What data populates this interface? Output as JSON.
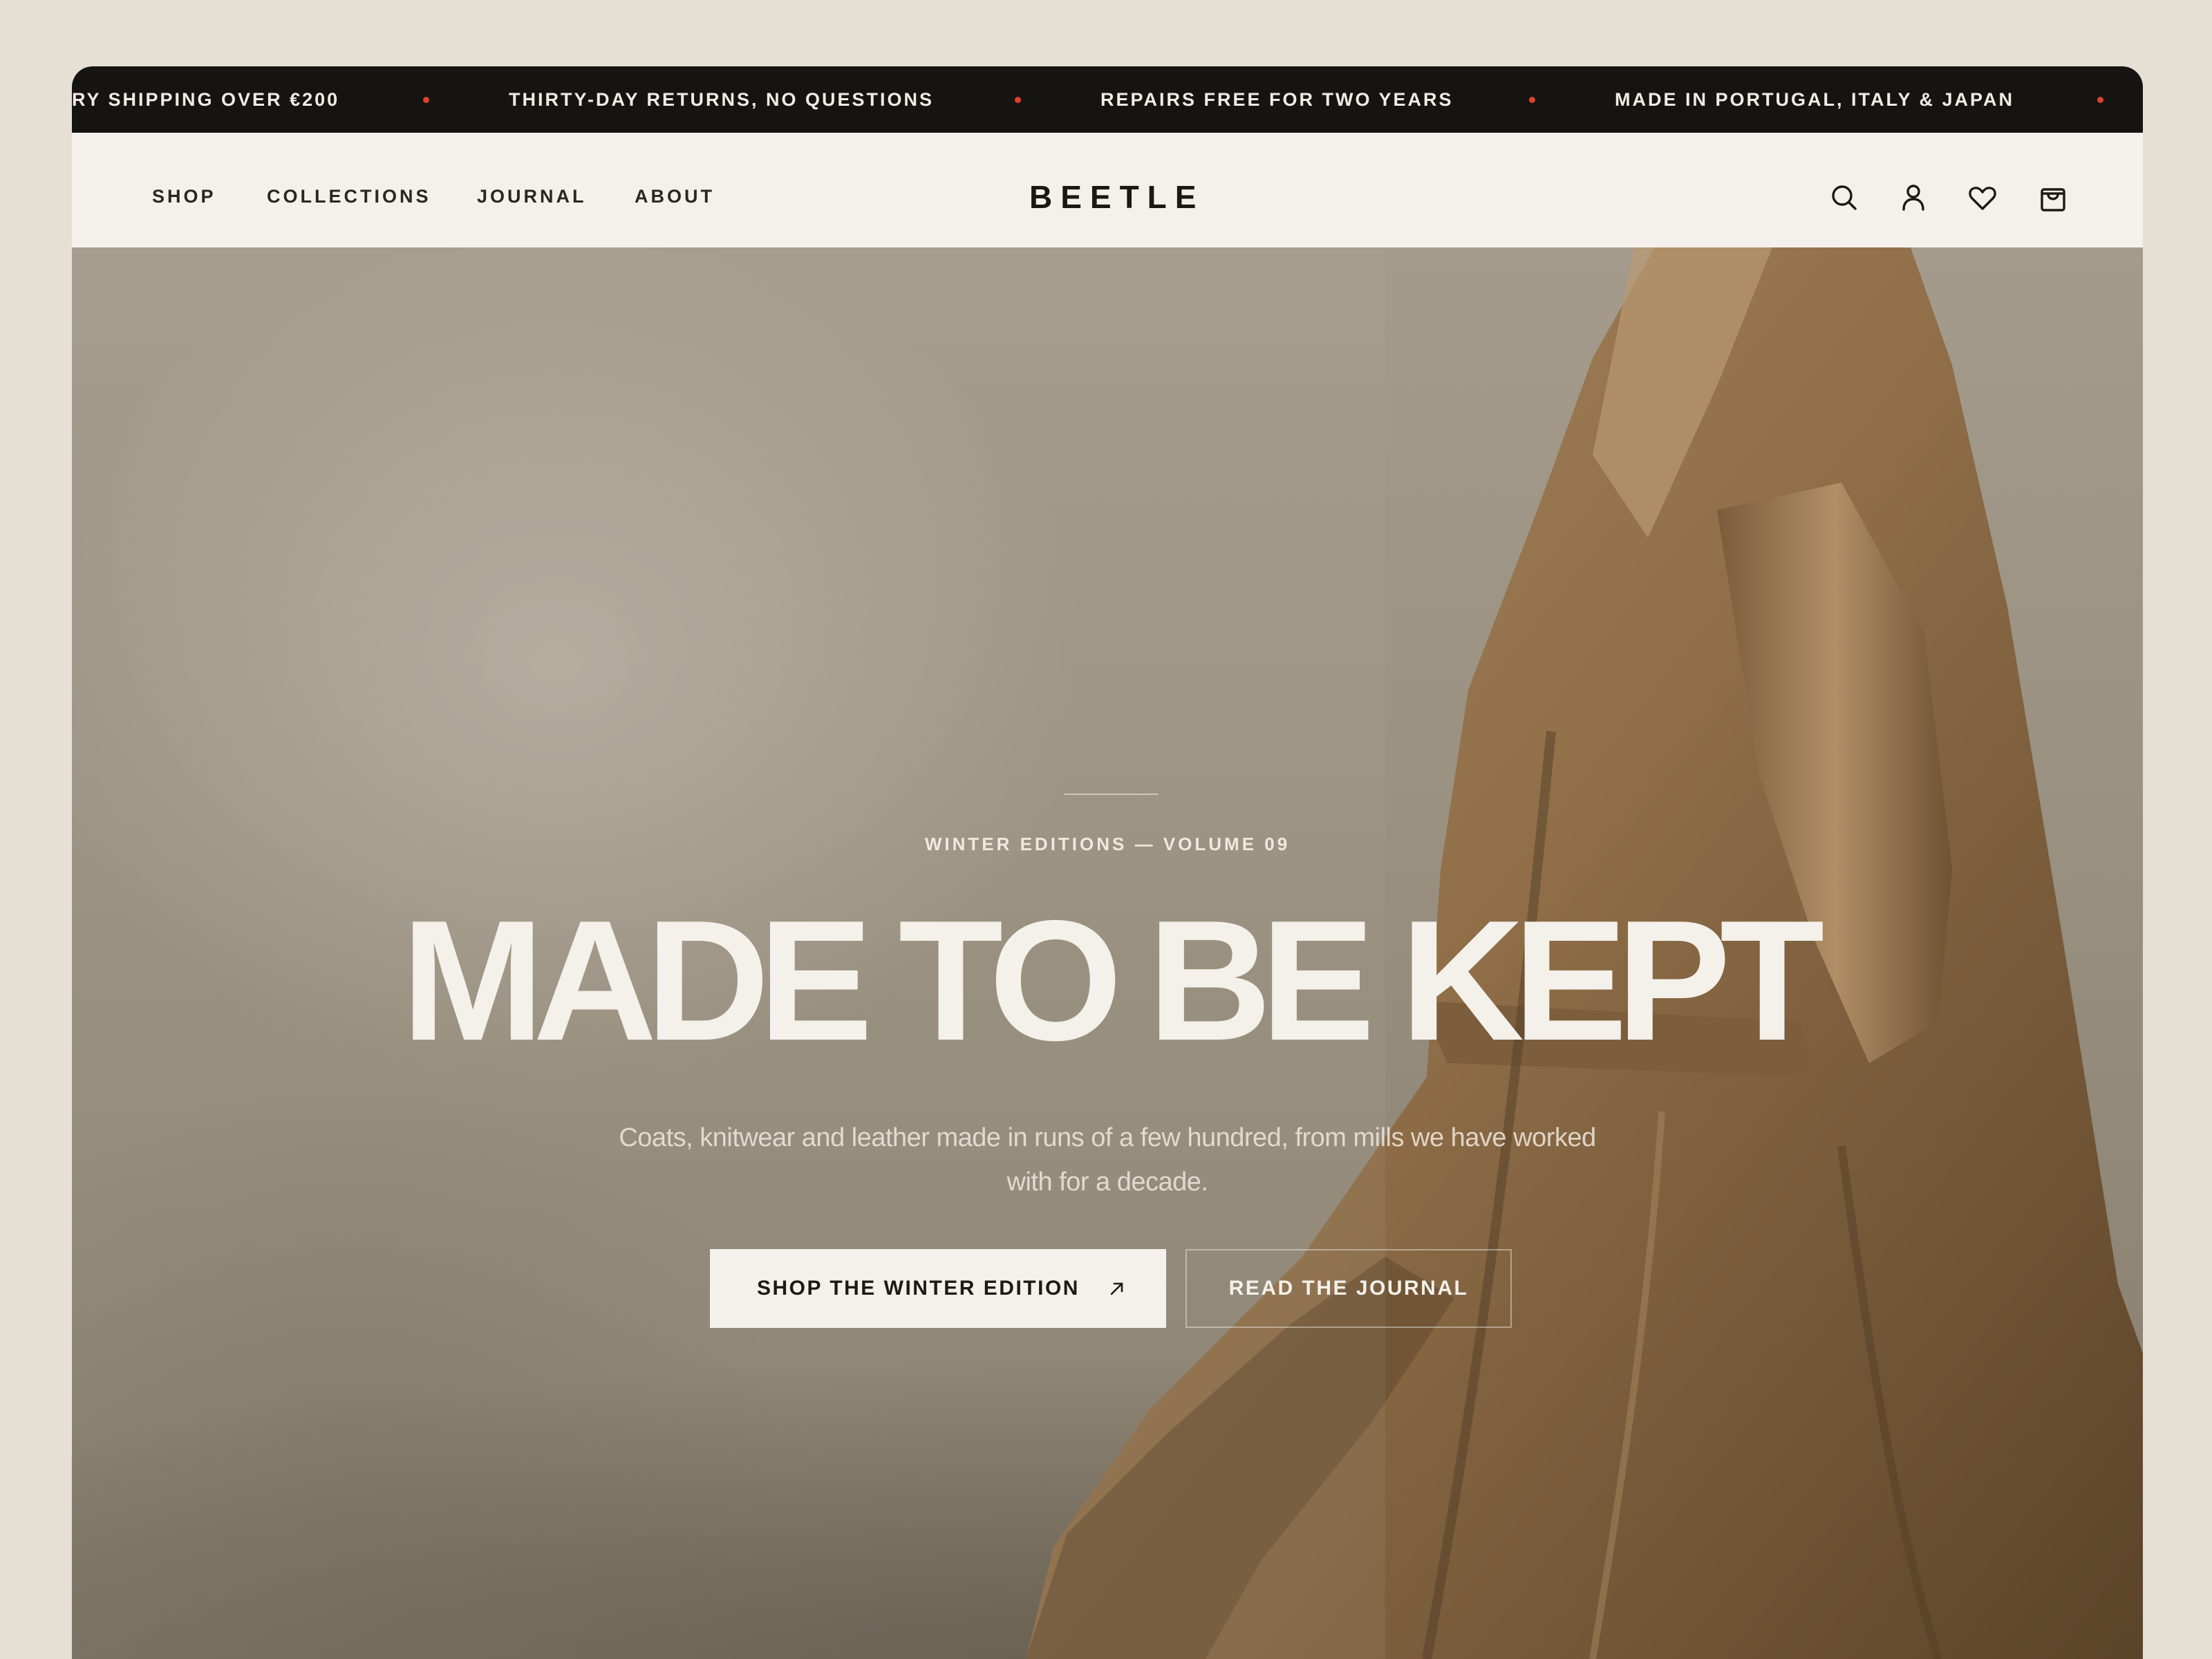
{
  "ticker": {
    "items": [
      "RY SHIPPING OVER €200",
      "THIRTY-DAY RETURNS, NO QUESTIONS",
      "REPAIRS FREE FOR TWO YEARS",
      "MADE IN PORTUGAL, ITALY & JAPAN"
    ],
    "dot_color": "#e0402b"
  },
  "header": {
    "nav": [
      "SHOP",
      "COLLECTIONS",
      "JOURNAL",
      "ABOUT"
    ],
    "logo": "BEETLE",
    "icons": [
      "search-icon",
      "account-icon",
      "heart-icon",
      "bag-icon"
    ]
  },
  "hero": {
    "eyebrow": "WINTER EDITIONS — VOLUME 09",
    "title": "MADE TO BE KEPT",
    "subtitle": "Coats, knitwear and leather made in runs of a few hundred, from mills we have worked with for a decade.",
    "primary_cta": "SHOP THE WINTER EDITION",
    "secondary_cta": "READ THE JOURNAL",
    "image_subject": "person in a camel wool coat, seen from behind"
  },
  "colors": {
    "background": "#e6dfd4",
    "ticker_bg": "#161412",
    "header_bg": "#f4f1ec",
    "accent": "#e0402b"
  }
}
